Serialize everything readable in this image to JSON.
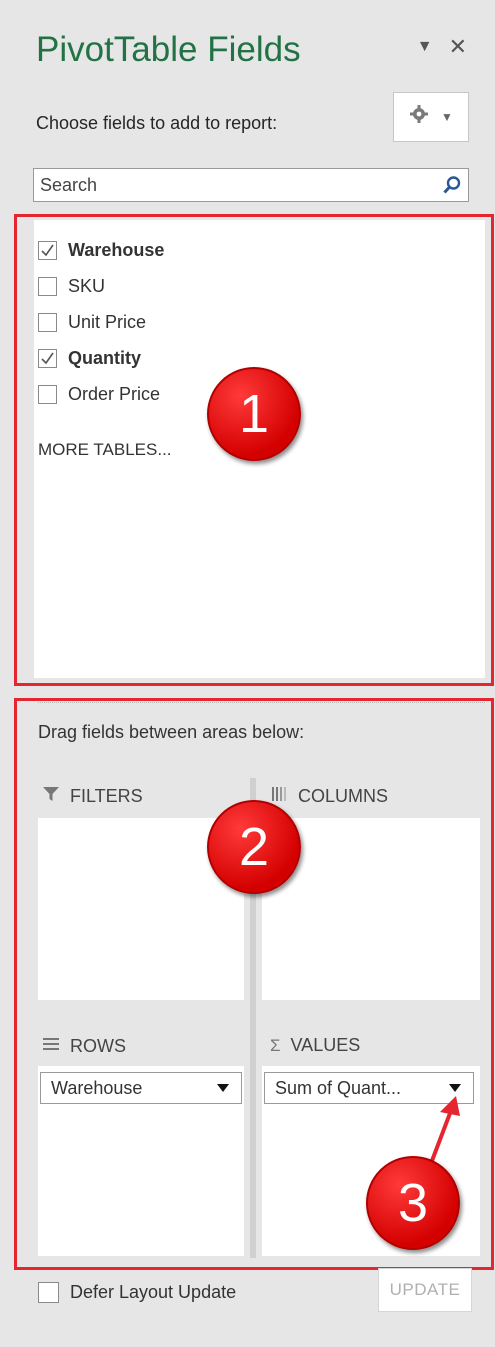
{
  "panel": {
    "title": "PivotTable Fields",
    "subtitle": "Choose fields to add to report:",
    "title_icons": [
      "chevron-down-icon",
      "close-icon"
    ]
  },
  "tools": {
    "icon": "gear-icon"
  },
  "search": {
    "placeholder": "Search",
    "icon": "search-icon"
  },
  "fields": [
    {
      "label": "Warehouse",
      "checked": true
    },
    {
      "label": "SKU",
      "checked": false
    },
    {
      "label": "Unit Price",
      "checked": false
    },
    {
      "label": "Quantity",
      "checked": true
    },
    {
      "label": "Order Price",
      "checked": false
    }
  ],
  "more_tables": "MORE TABLES...",
  "areas": {
    "instruction": "Drag fields between areas below:",
    "filters": {
      "label": "FILTERS",
      "icon": "filter-icon"
    },
    "columns": {
      "label": "COLUMNS",
      "icon": "columns-icon"
    },
    "rows": {
      "label": "ROWS",
      "icon": "rows-icon",
      "items": [
        "Warehouse"
      ]
    },
    "values": {
      "label": "VALUES",
      "icon": "sigma-icon",
      "items": [
        "Sum of Quant..."
      ]
    }
  },
  "footer": {
    "defer_label": "Defer Layout Update",
    "defer_checked": false,
    "update_label": "UPDATE"
  },
  "annotations": [
    "1",
    "2",
    "3"
  ],
  "colors": {
    "title": "#217346",
    "annotation_red": "#e52530"
  }
}
